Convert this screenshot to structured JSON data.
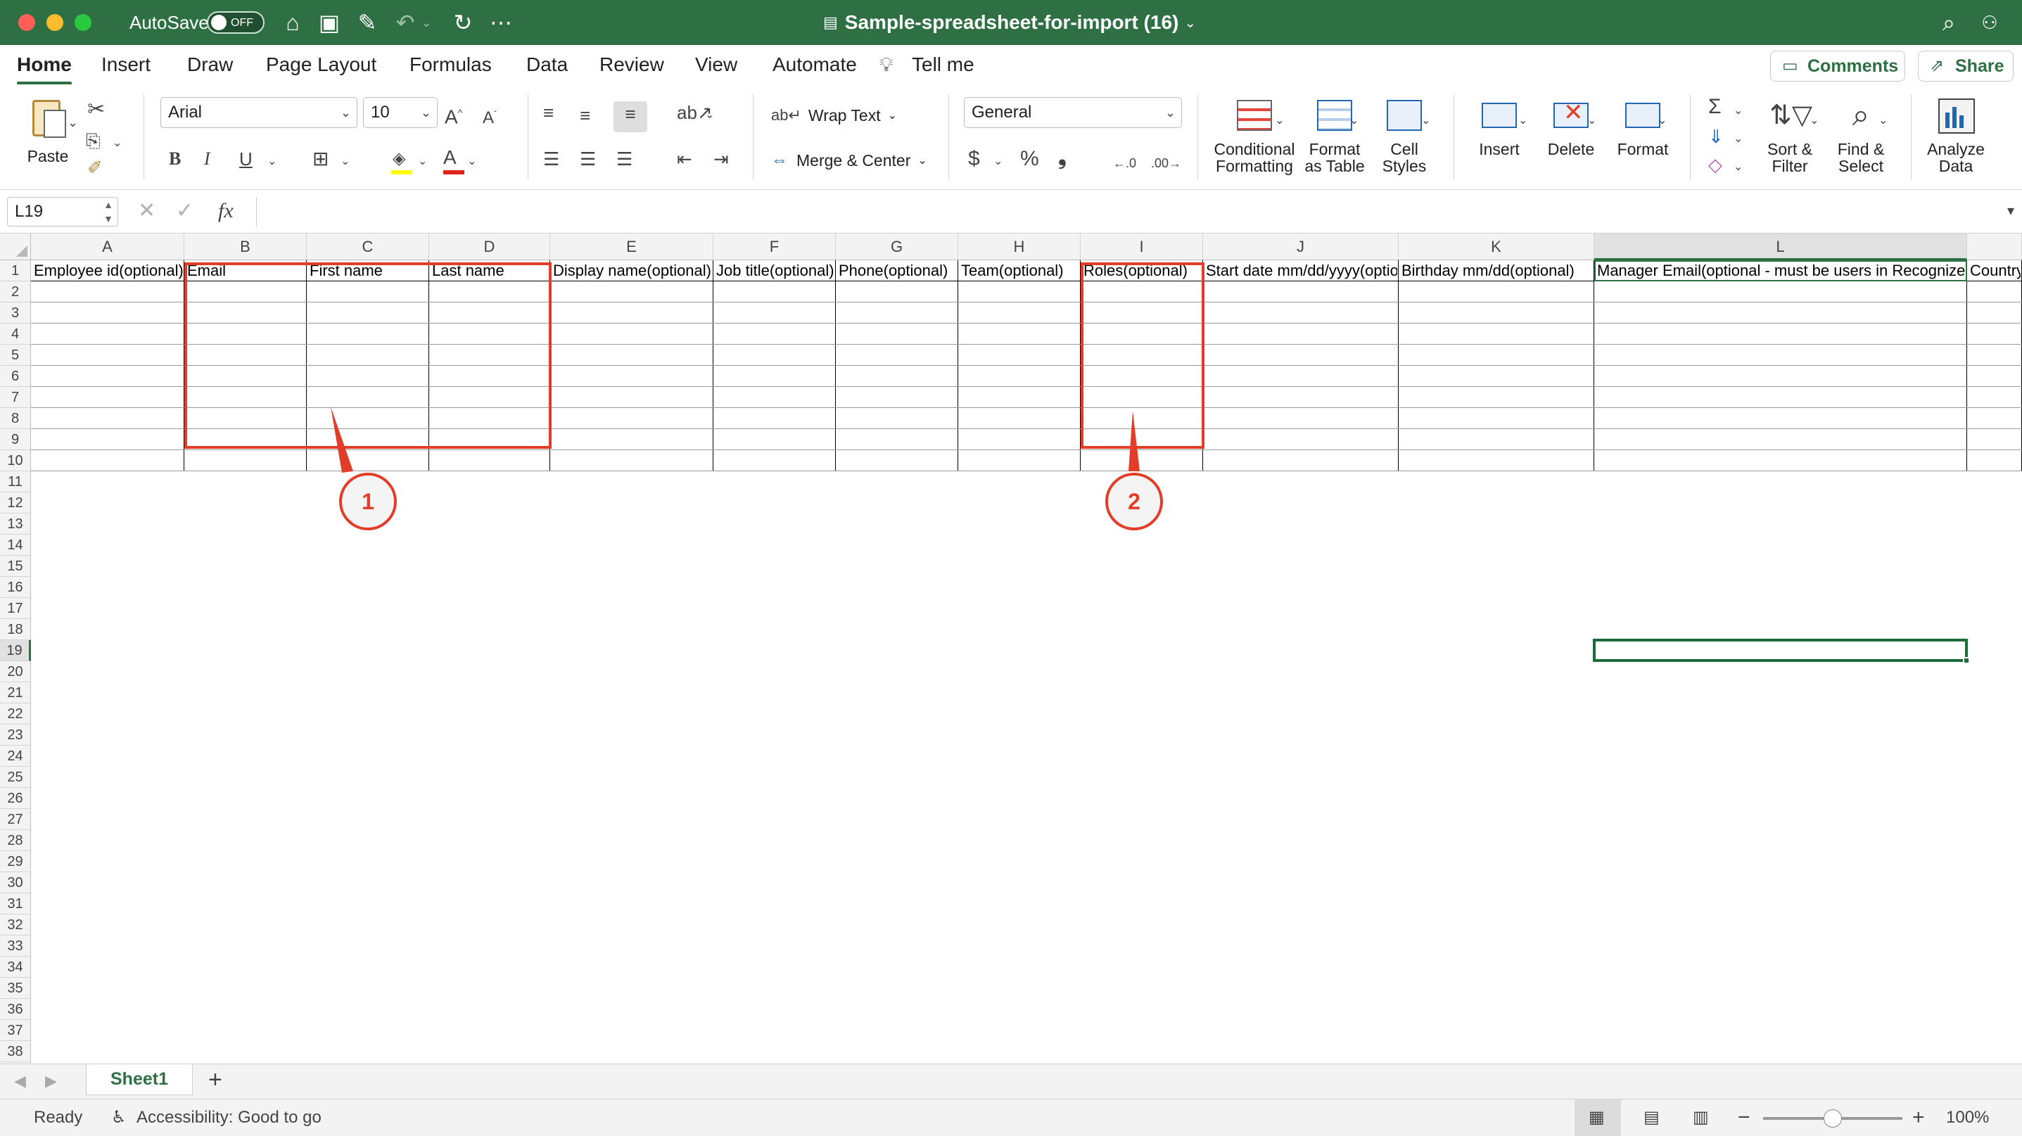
{
  "titlebar": {
    "autosave_label": "AutoSave",
    "autosave_state": "OFF",
    "title": "Sample-spreadsheet-for-import (16)",
    "accent": "#2e7043"
  },
  "menu": {
    "tabs": [
      "Home",
      "Insert",
      "Draw",
      "Page Layout",
      "Formulas",
      "Data",
      "Review",
      "View",
      "Automate"
    ],
    "tell_me": "Tell me",
    "comments": "Comments",
    "share": "Share"
  },
  "ribbon": {
    "paste": "Paste",
    "font_name": "Arial",
    "font_size": "10",
    "wrap_text": "Wrap Text",
    "merge_center": "Merge & Center",
    "number_format": "General",
    "conditional_formatting": [
      "Conditional",
      "Formatting"
    ],
    "format_as_table": [
      "Format",
      "as Table"
    ],
    "cell_styles": [
      "Cell",
      "Styles"
    ],
    "insert": "Insert",
    "delete": "Delete",
    "format": "Format",
    "sort_filter": [
      "Sort &",
      "Filter"
    ],
    "find_select": [
      "Find &",
      "Select"
    ],
    "analyze_data": [
      "Analyze",
      "Data"
    ]
  },
  "formula_bar": {
    "name_box": "L19",
    "fx": "fx",
    "formula": ""
  },
  "grid": {
    "columns": [
      "A",
      "B",
      "C",
      "D",
      "E",
      "F",
      "G",
      "H",
      "I",
      "J",
      "K",
      "L",
      ""
    ],
    "header_row": [
      "Employee id(optional)",
      "Email",
      "First name",
      "Last name",
      "Display name(optional)",
      "Job title(optional)",
      "Phone(optional)",
      "Team(optional)",
      "Roles(optional)",
      "Start date mm/dd/yyyy(optional)",
      "Birthday mm/dd(optional)",
      "Manager Email(optional - must be users in Recognize)",
      "Country"
    ],
    "selected_cell": "L19",
    "row_count": 39
  },
  "annotations": {
    "callout_1": "1",
    "callout_2": "2",
    "color": "#e23d28"
  },
  "sheets": {
    "tabs": [
      "Sheet1"
    ],
    "add": "+"
  },
  "status": {
    "ready": "Ready",
    "accessibility": "Accessibility: Good to go",
    "zoom": "100%",
    "zoom_value": 1.0
  }
}
